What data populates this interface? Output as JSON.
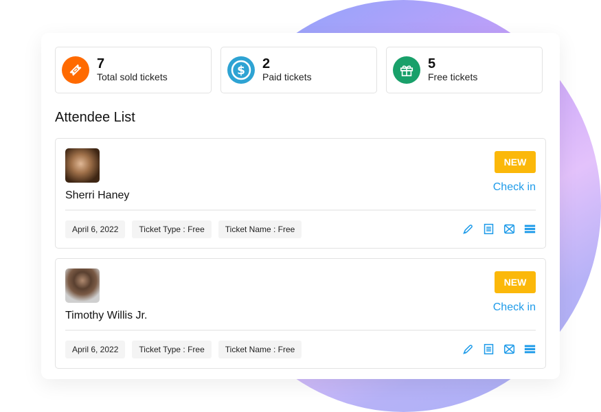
{
  "stats": [
    {
      "value": "7",
      "label": "Total sold tickets",
      "icon": "ticket-icon",
      "color": "#ff6a00"
    },
    {
      "value": "2",
      "label": "Paid tickets",
      "icon": "dollar-icon",
      "color": "#2ea3d3"
    },
    {
      "value": "5",
      "label": "Free tickets",
      "icon": "gift-icon",
      "color": "#19a06a"
    }
  ],
  "attendee_list": {
    "title": "Attendee List",
    "attendees": [
      {
        "name": "Sherri Haney",
        "badge": "NEW",
        "check_in_label": "Check in",
        "date": "April 6, 2022",
        "ticket_type": "Ticket Type : Free",
        "ticket_name": "Ticket Name : Free"
      },
      {
        "name": "Timothy Willis Jr.",
        "badge": "NEW",
        "check_in_label": "Check in",
        "date": "April 6, 2022",
        "ticket_type": "Ticket Type : Free",
        "ticket_name": "Ticket Name : Free"
      }
    ],
    "actions": [
      "edit-icon",
      "document-icon",
      "email-icon",
      "menu-icon"
    ]
  },
  "colors": {
    "accent": "#1e9be9",
    "badge": "#fbb80a"
  }
}
